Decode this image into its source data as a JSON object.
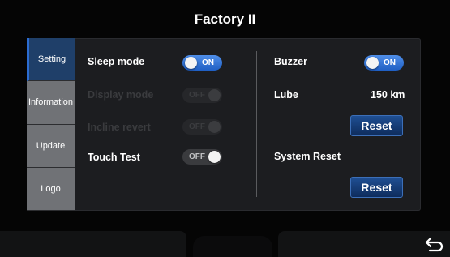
{
  "header": {
    "title": "Factory II"
  },
  "sidebar": {
    "items": [
      {
        "label": "Setting",
        "active": true
      },
      {
        "label": "Information"
      },
      {
        "label": "Update"
      },
      {
        "label": "Logo"
      }
    ]
  },
  "settings": {
    "sleep_mode": {
      "label": "Sleep mode",
      "toggle": "ON",
      "state": "on"
    },
    "display_mode": {
      "label": "Display mode",
      "toggle": "OFF",
      "state": "disabled"
    },
    "incline_revert": {
      "label": "Incline  revert",
      "toggle": "OFF",
      "state": "disabled"
    },
    "touch_test": {
      "label": "Touch Test",
      "toggle": "OFF",
      "state": "off"
    },
    "buzzer": {
      "label": "Buzzer",
      "toggle": "ON",
      "state": "on"
    },
    "lube": {
      "label": "Lube",
      "value": "150 km",
      "button": "Reset"
    },
    "system_reset": {
      "label": "System Reset",
      "button": "Reset"
    }
  },
  "footer": {
    "back_icon": "return-arrow-icon"
  },
  "colors": {
    "accent": "#2b6cd1",
    "toggle_on": "#3b7fe0",
    "button": "#1a4584",
    "sidebar_active": "#1f3f69",
    "sidebar_inactive": "#707276"
  }
}
